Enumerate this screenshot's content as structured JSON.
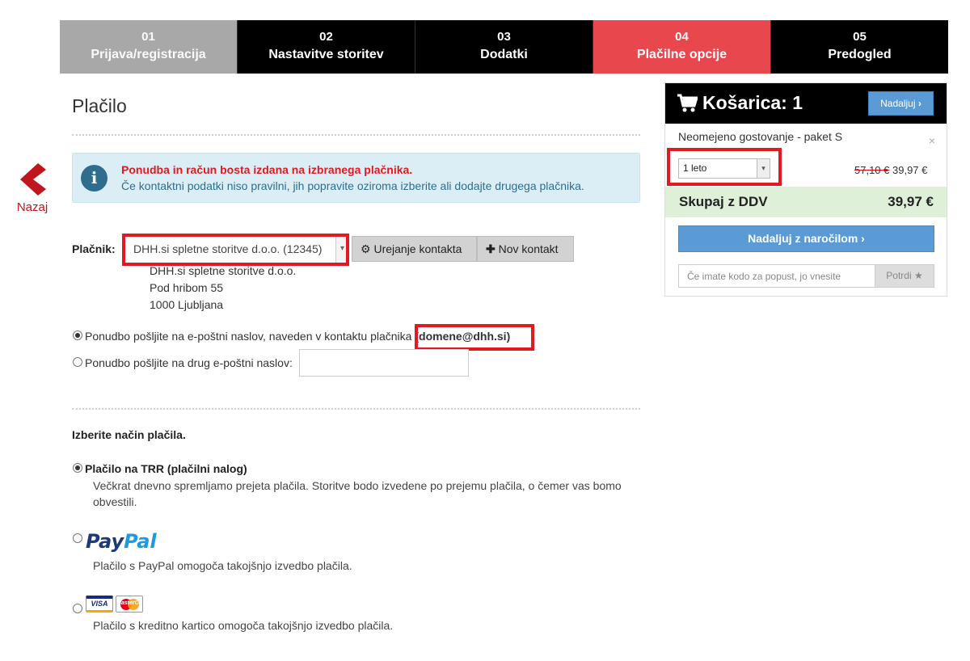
{
  "steps": [
    {
      "num": "01",
      "label": "Prijava/registracija",
      "state": "done"
    },
    {
      "num": "02",
      "label": "Nastavitve storitev",
      "state": "normal"
    },
    {
      "num": "03",
      "label": "Dodatki",
      "state": "normal"
    },
    {
      "num": "04",
      "label": "Plačilne opcije",
      "state": "active"
    },
    {
      "num": "05",
      "label": "Predogled",
      "state": "normal"
    }
  ],
  "back": {
    "label": "Nazaj",
    "icon": "chevron-left-icon"
  },
  "page": {
    "title": "Plačilo"
  },
  "alert": {
    "icon": "info-icon",
    "line1": "Ponudba in račun bosta izdana na izbranega plačnika.",
    "line2": "Če kontaktni podatki niso pravilni, jih popravite oziroma izberite ali dodajte drugega plačnika."
  },
  "payer": {
    "label": "Plačnik:",
    "selected": "DHH.si spletne storitve d.o.o. (12345)",
    "edit_button": "Urejanje kontakta",
    "new_button": "Nov kontakt",
    "address": [
      "DHH.si spletne storitve d.o.o.",
      "Pod hribom 55",
      "1000 Ljubljana"
    ]
  },
  "offer": {
    "option1_text": "Ponudbo pošljite na e-poštni naslov, naveden v kontaktu plačnika",
    "option1_email": "(domene@dhh.si)",
    "option2_text": "Ponudbo pošljite na drug e-poštni naslov:",
    "selected": "option1"
  },
  "payment": {
    "heading": "Izberite način plačila.",
    "methods": [
      {
        "title": "Plačilo na TRR (plačilni nalog)",
        "desc_line1": "Večkrat dnevno spremljamo prejeta plačila. Storitve bodo izvedene po prejemu plačila, o čemer vas bomo",
        "desc_line2": "obvestili.",
        "selected": true
      },
      {
        "brand_part1": "Pay",
        "brand_part2": "Pal",
        "desc": "Plačilo s PayPal omogoča takojšnjo izvedbo plačila.",
        "selected": false
      },
      {
        "card1": "VISA",
        "card2": "MasterCard",
        "desc": "Plačilo s kreditno kartico omogoča takojšnjo izvedbo plačila.",
        "selected": false
      }
    ]
  },
  "cart": {
    "title": "Košarica: 1",
    "icon": "cart-icon",
    "continue_small": "Nadaljuj",
    "item_name": "Neomejeno gostovanje - paket S",
    "remove": "×",
    "period": "1 leto",
    "old_price": "57,10 €",
    "new_price": "39,97 €",
    "total_label": "Skupaj z DDV",
    "total_value": "39,97 €",
    "continue_order": "Nadaljuj z naročilom",
    "coupon_placeholder": "Če imate kodo za popust, jo vnesite",
    "coupon_button": "Potrdi"
  },
  "colors": {
    "active_step": "#e7474d",
    "done_step": "#a8a8a8",
    "highlight": "#e2191f",
    "blue": "#5b9bd5",
    "total_bg": "#dff0d8"
  }
}
